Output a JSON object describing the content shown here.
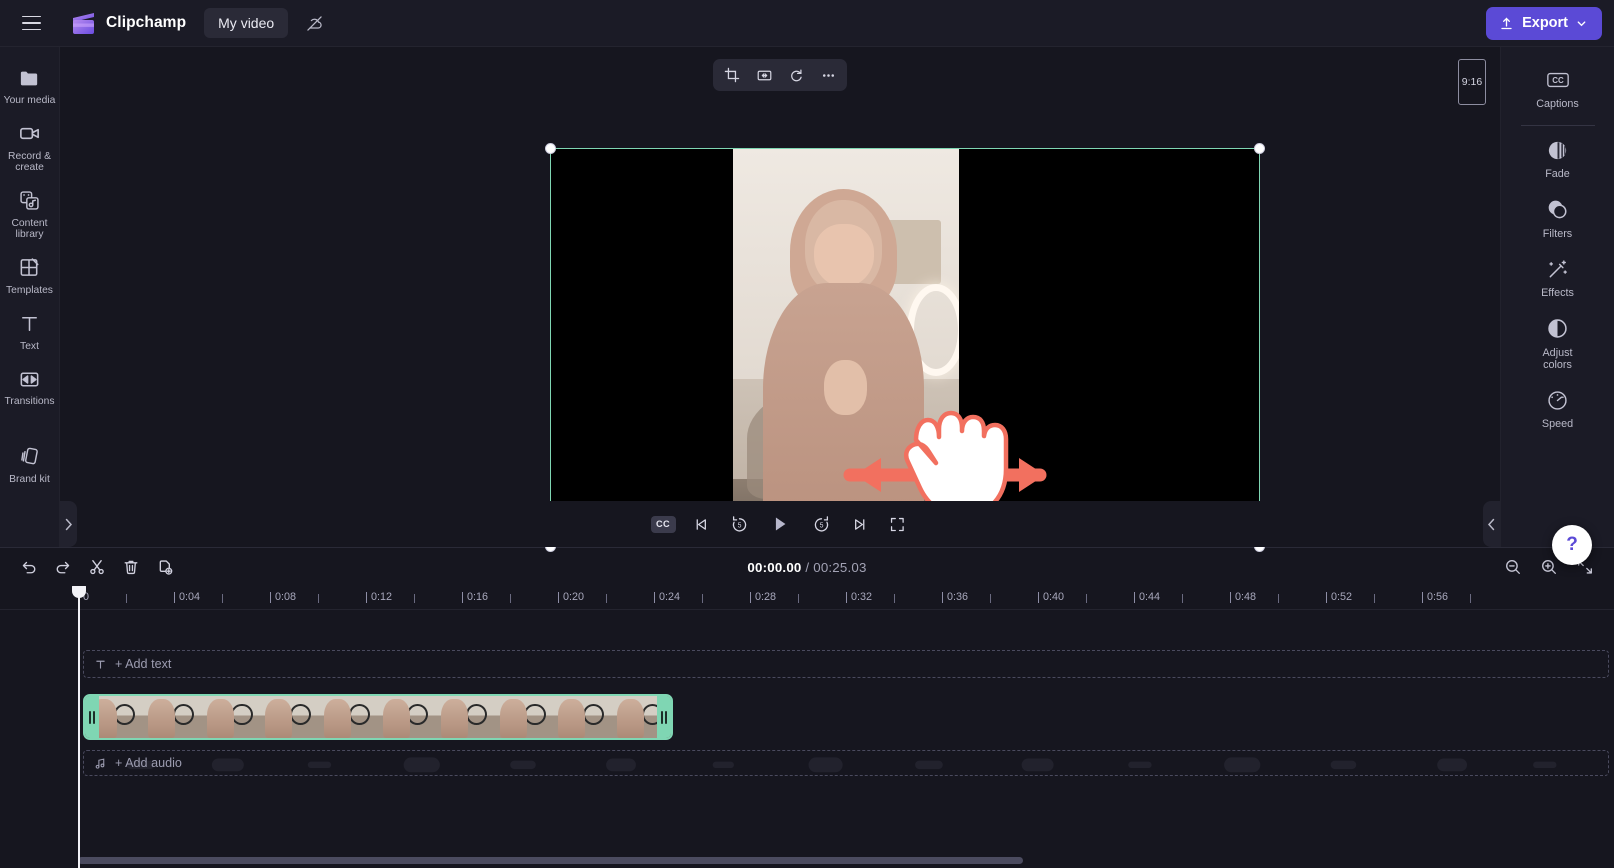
{
  "app": {
    "brand_name": "Clipchamp",
    "project_name": "My video",
    "menu_icon": "hamburger-icon",
    "cloud_icon": "cloud-off-icon"
  },
  "topbar": {
    "export_label": "Export",
    "export_icon": "upload-icon",
    "export_caret": "chevron-down-icon",
    "export_color": "#5b4ad6"
  },
  "sidebar_left": {
    "items": [
      {
        "label": "Your media",
        "icon": "folder-icon"
      },
      {
        "label": "Record &\ncreate",
        "label_line1": "Record &",
        "label_line2": "create",
        "icon": "video-camera-icon"
      },
      {
        "label": "Content\nlibrary",
        "label_line1": "Content",
        "label_line2": "library",
        "icon": "content-library-icon"
      },
      {
        "label": "Templates",
        "icon": "templates-icon"
      },
      {
        "label": "Text",
        "icon": "text-icon"
      },
      {
        "label": "Transitions",
        "icon": "transitions-icon"
      },
      {
        "label": "Brand kit",
        "icon": "brand-kit-icon"
      }
    ],
    "collapse_icon": "chevron-right-icon"
  },
  "sidebar_right": {
    "items": [
      {
        "label": "Captions",
        "icon": "cc-icon"
      },
      {
        "label": "Fade",
        "icon": "fade-icon"
      },
      {
        "label": "Filters",
        "icon": "filters-icon"
      },
      {
        "label": "Effects",
        "icon": "effects-wand-icon"
      },
      {
        "label": "Adjust\ncolors",
        "label_line1": "Adjust",
        "label_line2": "colors",
        "icon": "adjust-colors-icon"
      },
      {
        "label": "Speed",
        "icon": "speed-gauge-icon"
      }
    ],
    "collapse_icon": "chevron-left-icon",
    "help_label": "?"
  },
  "stage": {
    "aspect_ratio_label": "9:16",
    "float_toolbar": [
      {
        "name": "crop-icon",
        "tooltip": "Crop"
      },
      {
        "name": "fit-fill-icon",
        "tooltip": "Fit"
      },
      {
        "name": "rotate-icon",
        "tooltip": "Rotate"
      },
      {
        "name": "more-options-icon",
        "tooltip": "More"
      }
    ],
    "selection_color": "#7fd6b3",
    "overlay_arrow_color": "#f2705f"
  },
  "player": {
    "controls": [
      {
        "name": "captions-toggle",
        "label": "CC"
      },
      {
        "name": "skip-previous-icon",
        "label": ""
      },
      {
        "name": "rewind-5-icon",
        "label": "5"
      },
      {
        "name": "play-icon",
        "label": ""
      },
      {
        "name": "forward-5-icon",
        "label": "5"
      },
      {
        "name": "skip-next-icon",
        "label": ""
      },
      {
        "name": "fullscreen-icon",
        "label": ""
      }
    ]
  },
  "timeline": {
    "toolbar_left": [
      {
        "name": "undo-icon"
      },
      {
        "name": "redo-icon"
      },
      {
        "name": "split-scissors-icon"
      },
      {
        "name": "delete-trash-icon"
      },
      {
        "name": "duplicate-icon"
      }
    ],
    "toolbar_right": [
      {
        "name": "zoom-out-icon"
      },
      {
        "name": "zoom-in-icon"
      },
      {
        "name": "fit-timeline-icon"
      }
    ],
    "current_time": "00:00.00",
    "separator": "/",
    "total_time": "00:25.03",
    "ruler_labels": [
      "0",
      "0:04",
      "0:08",
      "0:12",
      "0:16",
      "0:20",
      "0:24",
      "0:28",
      "0:32",
      "0:36",
      "0:40",
      "0:44",
      "0:48",
      "0:52",
      "0:56"
    ],
    "add_text_label": "+ Add text",
    "add_text_icon": "text-t-icon",
    "add_audio_label": "+ Add audio",
    "add_audio_icon": "music-note-icon",
    "clip": {
      "selected": true,
      "border_color": "#7fd6b3",
      "left_handle": "trim-handle-left",
      "right_handle": "trim-handle-right"
    },
    "playhead_position": "0"
  }
}
